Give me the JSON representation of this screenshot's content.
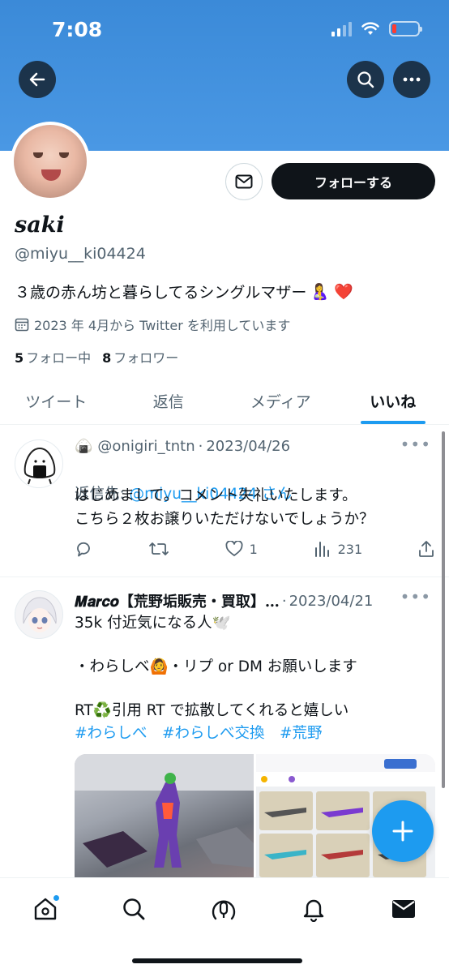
{
  "status_bar": {
    "time": "7:08"
  },
  "profile": {
    "display_name": "saki",
    "handle": "@miyu__ki04424",
    "bio": "３歳の赤ん坊と暮らしてるシングルマザー",
    "bio_emoji": "🤱 ❤️",
    "joined": "2023 年 4月から Twitter を利用しています",
    "following_count": "5",
    "following_label": "フォロー中",
    "followers_count": "8",
    "followers_label": "フォロワー",
    "follow_button": "フォローする"
  },
  "tabs": [
    {
      "label": "ツイート",
      "active": false
    },
    {
      "label": "返信",
      "active": false
    },
    {
      "label": "メディア",
      "active": false
    },
    {
      "label": "いいね",
      "active": true
    }
  ],
  "tweets": [
    {
      "author_emoji": "🍙",
      "author_handle": "@onigiri_tntn",
      "date": "2023/04/26",
      "reply_prefix": "返信先: ",
      "reply_to": "@miyu__ki04424",
      "reply_suffix": " さん",
      "text": "はじめまして。コメント失礼いたします。\nこちら２枚お譲りいただけないでしょうか？",
      "likes": "1",
      "views": "231"
    },
    {
      "author_name": "𝑴𝒂𝒓𝒄𝒐【荒野垢販売・買取】…",
      "date": "2023/04/21",
      "line1": "35k 付近気になる人🕊️",
      "line2": "・わらしベ🙆・リプ or DM お願いします",
      "line3": "RT♻️引用 RT で拡散してくれると嬉しい",
      "hashtags": "#わらしべ　#わらしべ交換　#荒野"
    }
  ],
  "colors": {
    "accent": "#1d9bf0",
    "banner": "#4a98e4",
    "text": "#0f1419",
    "muted": "#536471"
  }
}
